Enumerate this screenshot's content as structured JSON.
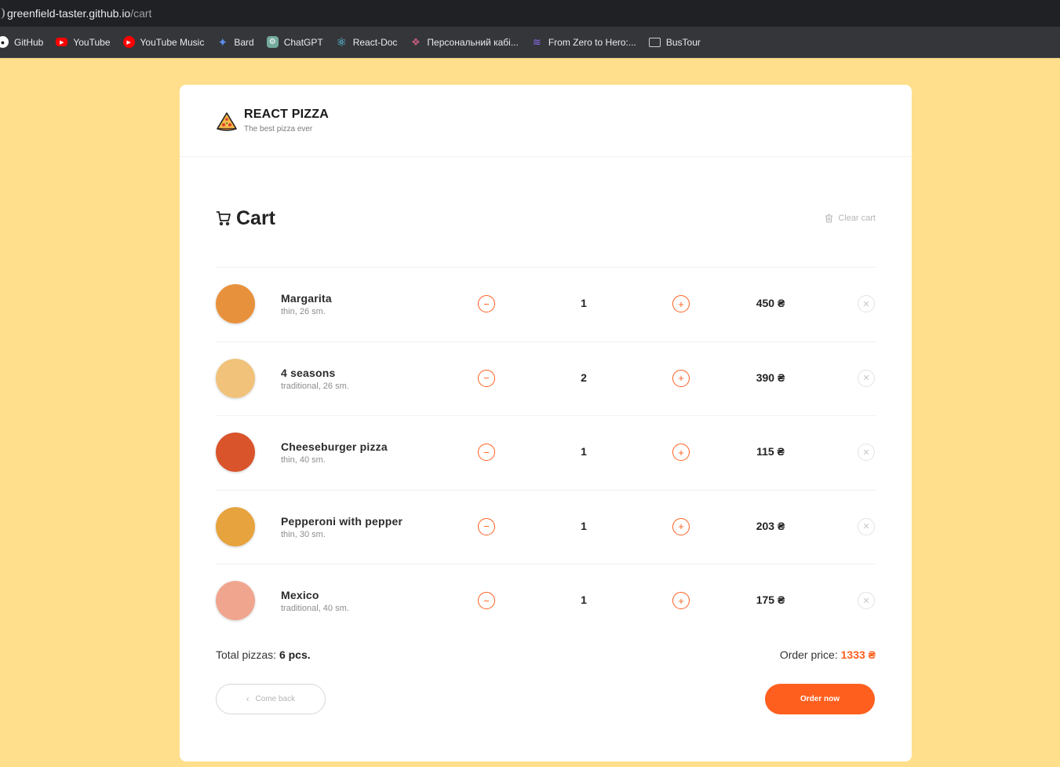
{
  "browser": {
    "url_host": "greenfield-taster.github.io",
    "url_path": "/cart",
    "bookmarks": [
      {
        "label": "GitHub",
        "icon": "github-icon",
        "color": "#ffffff"
      },
      {
        "label": "YouTube",
        "icon": "youtube-icon",
        "color": "#ff0000"
      },
      {
        "label": "YouTube Music",
        "icon": "youtube-music-icon",
        "color": "#ff0000"
      },
      {
        "label": "Bard",
        "icon": "bard-icon",
        "color": "#4285f4"
      },
      {
        "label": "ChatGPT",
        "icon": "chatgpt-icon",
        "color": "#74aa9c"
      },
      {
        "label": "React-Doc",
        "icon": "react-icon",
        "color": "#61dafb"
      },
      {
        "label": "Персональний кабі...",
        "icon": "bookmark-icon",
        "color": "#c25b7a"
      },
      {
        "label": "From Zero to Hero:...",
        "icon": "bookmark-icon",
        "color": "#8a6cf0"
      },
      {
        "label": "BusTour",
        "icon": "folder-icon",
        "color": "#cccccc"
      }
    ]
  },
  "header": {
    "title": "REACT PIZZA",
    "subtitle": "The best pizza ever"
  },
  "cart": {
    "title": "Cart",
    "clear_label": "Clear cart",
    "items": [
      {
        "name": "Margarita",
        "desc": "thin, 26 sm.",
        "qty": "1",
        "price": "450 ₴",
        "minus": "−",
        "plus": "+",
        "remove": "✕",
        "tone": "#e8913c"
      },
      {
        "name": "4 seasons",
        "desc": "traditional, 26 sm.",
        "qty": "2",
        "price": "390 ₴",
        "minus": "−",
        "plus": "+",
        "remove": "✕",
        "tone": "#f0c27a"
      },
      {
        "name": "Cheeseburger pizza",
        "desc": "thin, 40 sm.",
        "qty": "1",
        "price": "115 ₴",
        "minus": "−",
        "plus": "+",
        "remove": "✕",
        "tone": "#d9532b"
      },
      {
        "name": "Pepperoni with pepper",
        "desc": "thin, 30 sm.",
        "qty": "1",
        "price": "203 ₴",
        "minus": "−",
        "plus": "+",
        "remove": "✕",
        "tone": "#e6a33e"
      },
      {
        "name": "Mexico",
        "desc": "traditional, 40 sm.",
        "qty": "1",
        "price": "175 ₴",
        "minus": "−",
        "plus": "+",
        "remove": "✕",
        "tone": "#f0a58f"
      }
    ],
    "total_label": "Total pizzas:",
    "total_value": "6 pcs.",
    "order_price_label": "Order price:",
    "order_price_value": "1333 ₴",
    "back_label": "Come back",
    "order_label": "Order now"
  },
  "colors": {
    "accent": "#fe5f1e",
    "background": "#ffdf8c"
  }
}
